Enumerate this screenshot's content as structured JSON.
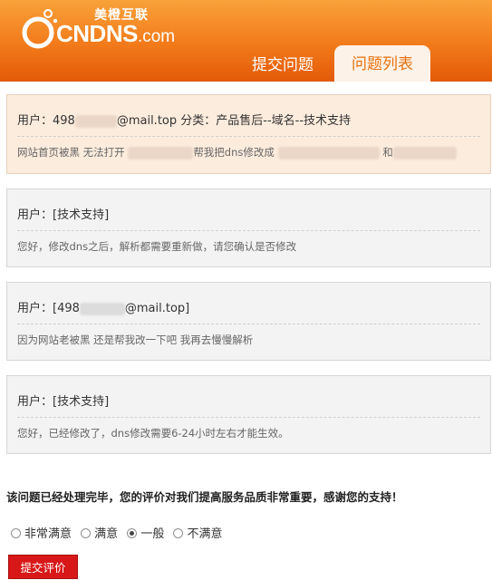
{
  "header": {
    "logo_cn": "美橙互联",
    "logo_text": "CNDNS",
    "logo_suffix": ".com",
    "tabs": [
      {
        "label": "提交问题",
        "active": false
      },
      {
        "label": "问题列表",
        "active": true
      }
    ]
  },
  "colors": {
    "header_orange": "#f27a1a",
    "active_tab_text": "#e8720f",
    "first_card_bg": "#fcecdd",
    "reply_card_bg": "#f3f3f3",
    "submit_button": "#d81818"
  },
  "question": {
    "user_prefix": "用户：498",
    "user_suffix": "@mail.top",
    "category_label": "分类：",
    "category": "产品售后--域名--技术支持",
    "body_part1": "网站首页被黑 无法打开",
    "body_part2": "帮我把dns修改成",
    "body_part3": "和"
  },
  "replies": [
    {
      "user": "用户：[技术支持]",
      "body": "您好，修改dns之后，解析都需要重新做，请您确认是否修改"
    },
    {
      "user_prefix": "用户：[498",
      "user_suffix": "@mail.top]",
      "body": "因为网站老被黑 还是帮我改一下吧 我再去慢慢解析"
    },
    {
      "user": "用户：[技术支持]",
      "body": "您好，已经修改了，dns修改需要6-24小时左右才能生效。"
    }
  ],
  "rating": {
    "notice": "该问题已经处理完毕，您的评价对我们提高服务品质非常重要，感谢您的支持！",
    "options": [
      "非常满意",
      "满意",
      "一般",
      "不满意"
    ],
    "selected": "一般",
    "submit_label": "提交评价"
  }
}
